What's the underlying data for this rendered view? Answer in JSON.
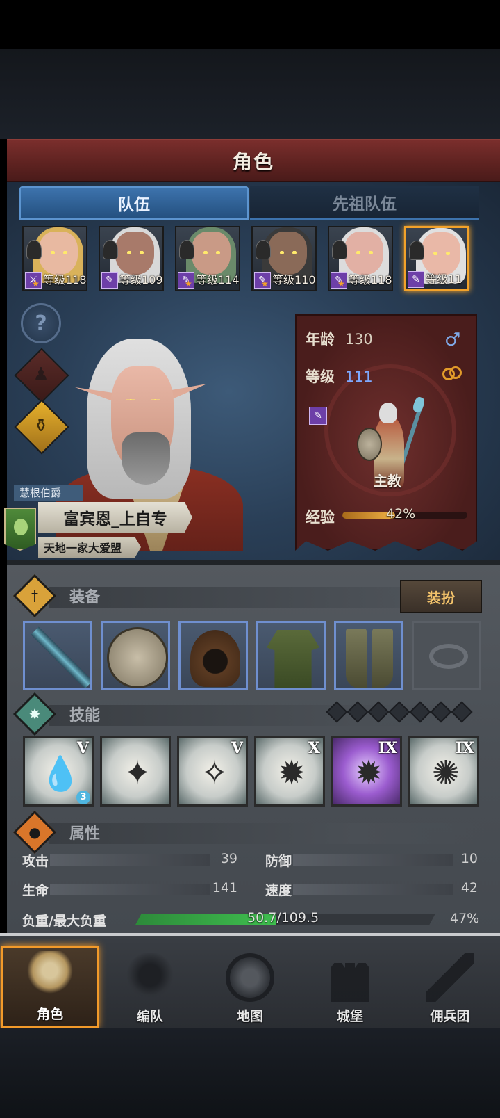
{
  "screen": {
    "title": "角色"
  },
  "tabs": [
    {
      "label": "队伍",
      "active": true
    },
    {
      "label": "先祖队伍",
      "active": false
    }
  ],
  "team": [
    {
      "level_text": "等级118",
      "class_icon": "sword-icon",
      "hair": "#d9b25a",
      "skin": "#e8b9a1",
      "star": true
    },
    {
      "level_text": "等级109",
      "class_icon": "staff-icon",
      "hair": "#d8d8d8",
      "skin": "#a87a6a",
      "star": false
    },
    {
      "level_text": "等级114",
      "class_icon": "staff-icon",
      "hair": "#6a8a6a",
      "skin": "#c99a86",
      "star": true
    },
    {
      "level_text": "等级110",
      "class_icon": "staff-icon",
      "hair": "#3a3a3a",
      "skin": "#8a6a58",
      "star": true
    },
    {
      "level_text": "等级118",
      "class_icon": "staff-icon",
      "hair": "#dcdcdc",
      "skin": "#e2b0a4",
      "star": true
    },
    {
      "level_text": "等级11",
      "class_icon": "staff-icon",
      "hair": "#e0e0e0",
      "skin": "#e9b8a7",
      "star": false,
      "selected": true
    }
  ],
  "side_buttons": {
    "help": "?",
    "unit": "unit-icon",
    "potion": "potion-icon"
  },
  "hero": {
    "rank": "慧根伯爵",
    "name": "富宾恩_上自专",
    "guild": "天地一家大爱盟",
    "age_label": "年龄",
    "age": "130",
    "level_label": "等级",
    "level": "111",
    "gender_symbol": "♂",
    "class_name": "主教",
    "exp_label": "经验",
    "exp_percent_text": "42%",
    "exp_fraction": 0.42
  },
  "equipment": {
    "title": "装备",
    "dress_button": "装扮",
    "slots": [
      "staff",
      "shield",
      "hood",
      "tunic",
      "boots",
      "ring-empty"
    ]
  },
  "skills": {
    "title": "技能",
    "items": [
      {
        "tier": "V",
        "badge": "3",
        "purple": false
      },
      {
        "tier": "",
        "badge": "",
        "purple": false
      },
      {
        "tier": "V",
        "badge": "",
        "purple": false
      },
      {
        "tier": "X",
        "badge": "",
        "purple": false
      },
      {
        "tier": "IX",
        "badge": "",
        "purple": true
      },
      {
        "tier": "IX",
        "badge": "",
        "purple": false
      }
    ],
    "empty_slots": 7
  },
  "attributes": {
    "title": "属性",
    "attack_label": "攻击",
    "attack": "39",
    "defense_label": "防御",
    "defense": "10",
    "hp_label": "生命",
    "hp": "141",
    "speed_label": "速度",
    "speed": "42",
    "load_label": "负重/最大负重",
    "load_text": "50.7/109.5",
    "load_percent_text": "47%",
    "load_fraction": 0.47
  },
  "nav": [
    {
      "label": "角色",
      "active": true
    },
    {
      "label": "编队",
      "active": false
    },
    {
      "label": "地图",
      "active": false
    },
    {
      "label": "城堡",
      "active": false
    },
    {
      "label": "佣兵团",
      "active": false
    }
  ],
  "colors": {
    "accent": "#f2a22a",
    "tab_active": "#3d73ad",
    "panel_red": "#6f2f2d",
    "load_green": "#3fbf4f",
    "exp_orange": "#f2b246"
  }
}
